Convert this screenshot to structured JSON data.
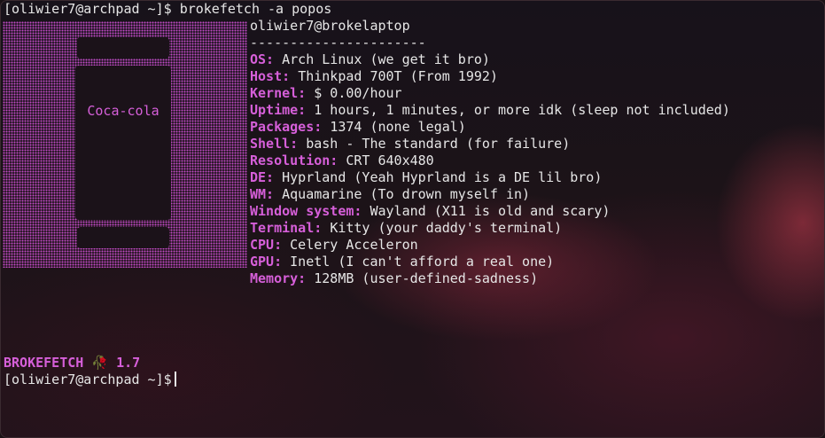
{
  "terminal": {
    "prompt": "[oliwier7@archpad ~]$",
    "command": "brokefetch -a popos",
    "brand_name": "BROKEFETCH",
    "brand_icon": "🥀",
    "version": "1.7"
  },
  "ascii_label": "Coca-cola",
  "header": {
    "user_host": "oliwier7@brokelaptop",
    "separator": "----------------------"
  },
  "info": [
    {
      "key": "OS:",
      "value": "Arch Linux (we get it bro)"
    },
    {
      "key": "Host:",
      "value": "Thinkpad 700T (From 1992)"
    },
    {
      "key": "Kernel:",
      "value": "$ 0.00/hour"
    },
    {
      "key": "Uptime:",
      "value": "1 hours, 1 minutes, or more idk (sleep not included)"
    },
    {
      "key": "Packages:",
      "value": "1374 (none legal)"
    },
    {
      "key": "Shell:",
      "value": "bash - The standard (for failure)"
    },
    {
      "key": "Resolution:",
      "value": "CRT 640x480"
    },
    {
      "key": "DE:",
      "value": "Hyprland (Yeah Hyprland is a DE lil bro)"
    },
    {
      "key": "WM:",
      "value": "Aquamarine (To drown myself in)"
    },
    {
      "key": "Window system:",
      "value": "Wayland (X11 is old and scary)"
    },
    {
      "key": "Terminal:",
      "value": "Kitty (your daddy's terminal)"
    },
    {
      "key": "CPU:",
      "value": "Celery Acceleron"
    },
    {
      "key": "GPU:",
      "value": "Inetl (I can't afford a real one)"
    },
    {
      "key": "Memory:",
      "value": "128MB (user-defined-sadness)"
    }
  ],
  "colors": {
    "accent": "#d65fd9",
    "text": "#e6e6e6",
    "background": "#1a1216"
  }
}
